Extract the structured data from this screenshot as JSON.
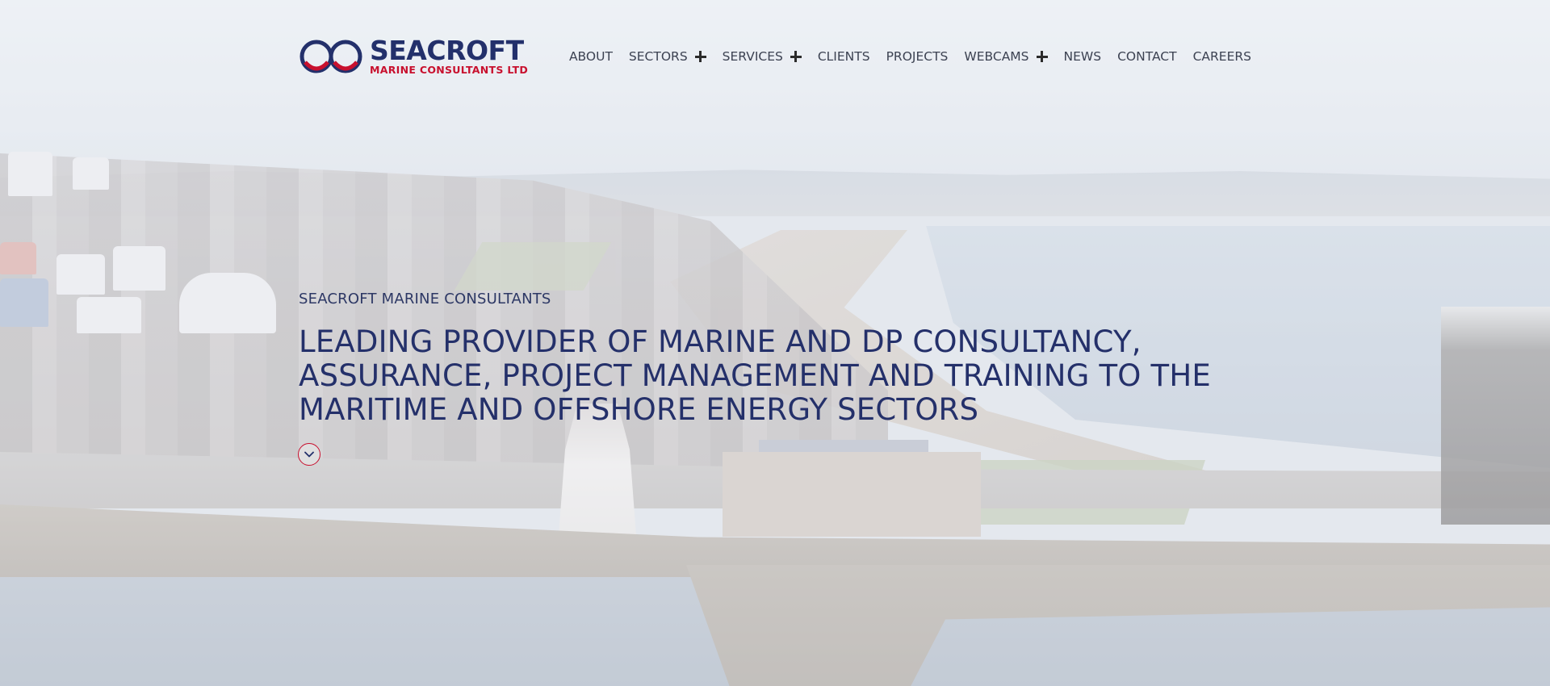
{
  "brand": {
    "name": "SEACROFT",
    "tagline": "MARINE CONSULTANTS LTD",
    "primary_color": "#23306b",
    "accent_color": "#c8102e"
  },
  "nav": {
    "items": [
      {
        "label": "ABOUT",
        "has_submenu": false
      },
      {
        "label": "SECTORS",
        "has_submenu": true
      },
      {
        "label": "SERVICES",
        "has_submenu": true
      },
      {
        "label": "CLIENTS",
        "has_submenu": false
      },
      {
        "label": "PROJECTS",
        "has_submenu": false
      },
      {
        "label": "WEBCAMS",
        "has_submenu": true
      },
      {
        "label": "NEWS",
        "has_submenu": false
      },
      {
        "label": "CONTACT",
        "has_submenu": false
      },
      {
        "label": "CAREERS",
        "has_submenu": false
      }
    ],
    "submenu_icon": "plus-icon"
  },
  "hero": {
    "eyebrow": "SEACROFT MARINE CONSULTANTS",
    "headline": "LEADING PROVIDER OF MARINE AND DP CONSULTANCY, ASSURANCE, PROJECT MANAGEMENT AND TRAINING TO THE MARITIME AND OFFSHORE ENERGY SECTORS",
    "scroll_icon": "chevron-down-icon",
    "background": "aerial-harbour-photo"
  }
}
